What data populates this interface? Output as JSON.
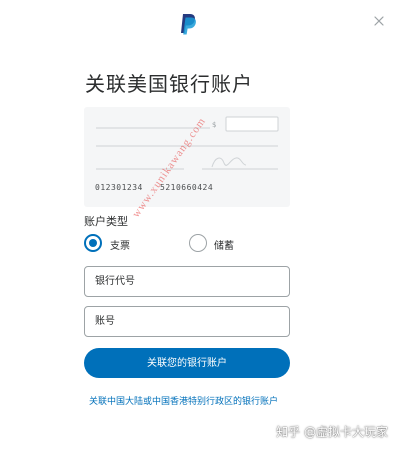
{
  "header": {
    "logo_icon": "paypal-logo-icon",
    "close_icon": "close-icon"
  },
  "title": "关联美国银行账户",
  "cheque": {
    "routing_number": "012301234",
    "account_number": "5210660424"
  },
  "account_type": {
    "label": "账户类型",
    "options": [
      {
        "label": "支票",
        "selected": true
      },
      {
        "label": "储蓄",
        "selected": false
      }
    ]
  },
  "form": {
    "routing_placeholder": "银行代号",
    "account_placeholder": "账号"
  },
  "submit_label": "关联您的银行账户",
  "alt_link": "关联中国大陆或中国香港特别行政区的银行账户",
  "watermarks": {
    "diagonal": "www.xunikawang.com",
    "corner": "知乎 @虚拟卡大玩家"
  },
  "colors": {
    "accent": "#0070ba",
    "watermark": "#e63c3c"
  }
}
